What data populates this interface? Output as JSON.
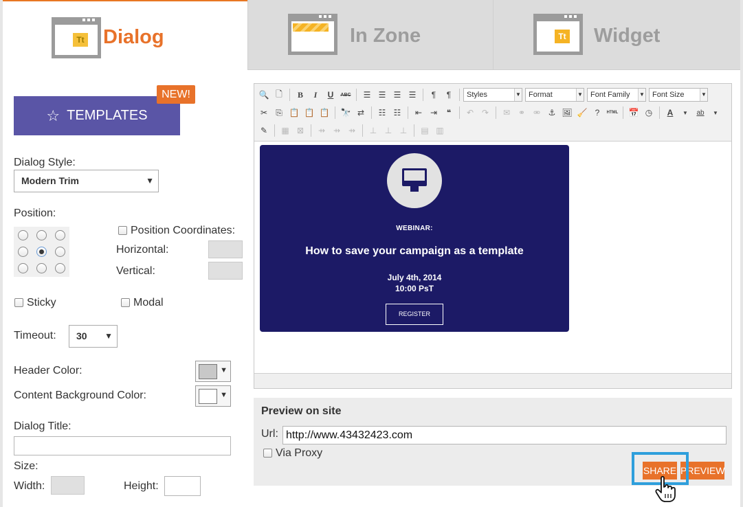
{
  "tabs": [
    {
      "label": "Dialog",
      "icon": "dialog-window-icon",
      "active": true
    },
    {
      "label": "In Zone",
      "icon": "in-zone-window-icon",
      "active": false
    },
    {
      "label": "Widget",
      "icon": "widget-window-icon",
      "active": false
    }
  ],
  "tab_icon_text": "Tt",
  "colors": {
    "accent": "#e8722a",
    "templates": "#5a55a6",
    "webinar_bg": "#1c1a66",
    "highlight": "#2f9fdc"
  },
  "left": {
    "new_badge": "NEW!",
    "templates_label": "TEMPLATES",
    "dialog_style_label": "Dialog Style:",
    "dialog_style_value": "Modern Trim",
    "position_label": "Position:",
    "position_selected": "middle-center",
    "position_coordinates_label": "Position Coordinates:",
    "horizontal_label": "Horizontal:",
    "vertical_label": "Vertical:",
    "sticky_label": "Sticky",
    "modal_label": "Modal",
    "timeout_label": "Timeout:",
    "timeout_value": "30",
    "header_color_label": "Header Color:",
    "header_color": "#c8c8c8",
    "content_bg_label": "Content Background Color:",
    "content_bg_color": "#ffffff",
    "dialog_title_label": "Dialog Title:",
    "size_label": "Size:",
    "width_label": "Width:",
    "height_label": "Height:"
  },
  "toolbar": {
    "styles": "Styles",
    "format": "Format",
    "font_family": "Font Family",
    "font_size": "Font Size",
    "bold": "B",
    "italic": "I",
    "underline": "U",
    "strike": "ABC",
    "html": "HTML"
  },
  "webinar": {
    "kicker": "WEBINAR:",
    "title": "How to save your campaign as a template",
    "date": "July 4th, 2014",
    "time": "10:00 PsT",
    "register": "REGISTER"
  },
  "preview": {
    "heading": "Preview on site",
    "url_label": "Url:",
    "url_value": "http://www.43432423.com",
    "via_proxy_label": "Via Proxy",
    "share_label": "SHARE",
    "preview_label": "PREVIEW"
  }
}
